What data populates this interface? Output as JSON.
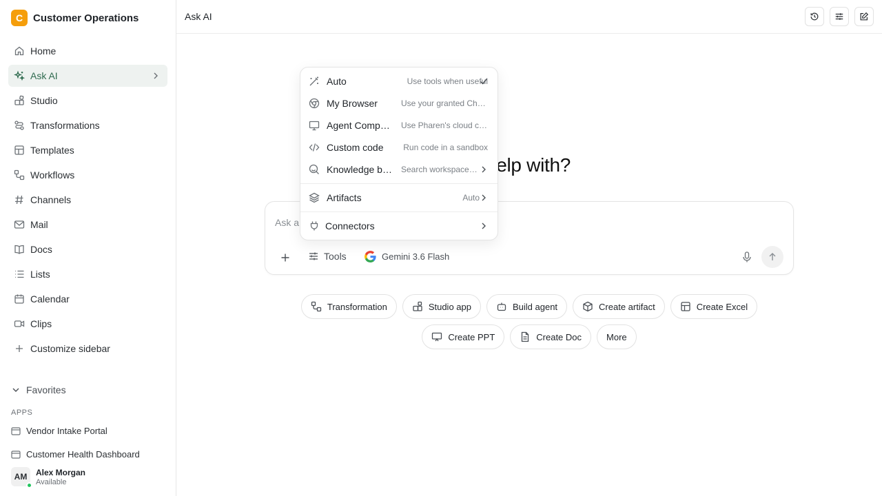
{
  "workspace": {
    "logo_letter": "C",
    "name": "Customer Operations"
  },
  "sidebar": {
    "items": [
      {
        "label": "Home",
        "icon": "home-icon"
      },
      {
        "label": "Ask AI",
        "icon": "sparkles-icon",
        "active": true
      },
      {
        "label": "Studio",
        "icon": "studio-icon"
      },
      {
        "label": "Transformations",
        "icon": "transformations-icon"
      },
      {
        "label": "Templates",
        "icon": "templates-icon"
      },
      {
        "label": "Workflows",
        "icon": "workflows-icon"
      },
      {
        "label": "Channels",
        "icon": "hash-icon"
      },
      {
        "label": "Mail",
        "icon": "mail-icon"
      },
      {
        "label": "Docs",
        "icon": "book-icon"
      },
      {
        "label": "Lists",
        "icon": "list-icon"
      },
      {
        "label": "Calendar",
        "icon": "calendar-icon"
      },
      {
        "label": "Clips",
        "icon": "video-icon"
      },
      {
        "label": "Customize sidebar",
        "icon": "plus-icon"
      }
    ],
    "favorites_label": "Favorites",
    "apps_label": "APPS",
    "apps": [
      {
        "label": "Vendor Intake Portal",
        "icon": "app-window-icon"
      },
      {
        "label": "Customer Health Dashboard",
        "icon": "app-window-icon"
      }
    ]
  },
  "user": {
    "initials": "AM",
    "name": "Alex Morgan",
    "status": "Available"
  },
  "header": {
    "title": "Ask AI"
  },
  "main": {
    "heading": "an I help with?",
    "composer": {
      "placeholder": "Ask a",
      "tools_label": "Tools",
      "model_label": "Gemini 3.6 Flash"
    },
    "chips_row1": [
      {
        "label": "Transformation",
        "icon": "transformations-icon"
      },
      {
        "label": "Studio app",
        "icon": "studio-icon"
      },
      {
        "label": "Build agent",
        "icon": "bot-icon"
      },
      {
        "label": "Create artifact",
        "icon": "box-icon"
      },
      {
        "label": "Create Excel",
        "icon": "table-icon"
      }
    ],
    "chips_row2": [
      {
        "label": "Create PPT",
        "icon": "presentation-icon"
      },
      {
        "label": "Create Doc",
        "icon": "document-icon"
      },
      {
        "label": "More",
        "icon": ""
      }
    ]
  },
  "tools_menu": {
    "items": [
      {
        "label": "Auto",
        "desc": "Use tools when useful",
        "end": "check"
      },
      {
        "label": "My Browser",
        "desc": "Use your granted Chrome browser",
        "end": ""
      },
      {
        "label": "Agent Computer",
        "desc": "Use Pharen's cloud computer",
        "end": ""
      },
      {
        "label": "Custom code",
        "desc": "Run code in a sandbox",
        "end": ""
      },
      {
        "label": "Knowledge base",
        "desc": "Search workspace knowledge",
        "end": "chevron"
      }
    ],
    "artifacts": {
      "label": "Artifacts",
      "value": "Auto"
    },
    "connectors": {
      "label": "Connectors"
    }
  }
}
